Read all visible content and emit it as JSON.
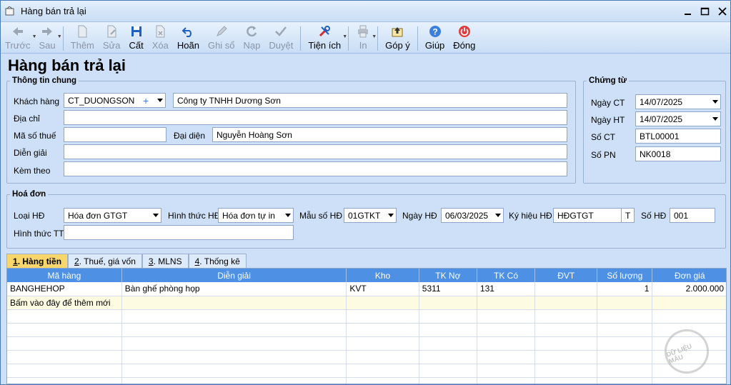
{
  "window": {
    "title": "Hàng bán trả lại"
  },
  "toolbar": {
    "items": [
      {
        "label": "Trước",
        "disabled": true
      },
      {
        "label": "Sau",
        "disabled": true
      },
      {
        "label": "Thêm",
        "disabled": true
      },
      {
        "label": "Sửa",
        "disabled": true
      },
      {
        "label": "Cất",
        "disabled": false
      },
      {
        "label": "Xóa",
        "disabled": true
      },
      {
        "label": "Hoãn",
        "disabled": false
      },
      {
        "label": "Ghi sổ",
        "disabled": true
      },
      {
        "label": "Nạp",
        "disabled": true
      },
      {
        "label": "Duyệt",
        "disabled": true
      },
      {
        "label": "Tiện ích",
        "disabled": false
      },
      {
        "label": "In",
        "disabled": true
      },
      {
        "label": "Góp ý",
        "disabled": false
      },
      {
        "label": "Giúp",
        "disabled": false
      },
      {
        "label": "Đóng",
        "disabled": false
      }
    ]
  },
  "page_title": "Hàng bán trả lại",
  "general": {
    "legend": "Thông tin chung",
    "customer_label": "Khách hàng",
    "customer_code": "CT_DUONGSON",
    "customer_name": "Công ty TNHH Dương Sơn",
    "address_label": "Địa chỉ",
    "address": "",
    "tax_label": "Mã số thuế",
    "tax": "",
    "rep_label": "Đại diện",
    "rep": "Nguyễn Hoàng Sơn",
    "desc_label": "Diễn giải",
    "desc": "",
    "attach_label": "Kèm theo",
    "attach": ""
  },
  "voucher": {
    "legend": "Chứng từ",
    "date_ct_label": "Ngày CT",
    "date_ct": "14/07/2025",
    "date_ht_label": "Ngày HT",
    "date_ht": "14/07/2025",
    "so_ct_label": "Số CT",
    "so_ct": "BTL00001",
    "so_pn_label": "Số PN",
    "so_pn": "NK0018"
  },
  "invoice": {
    "legend": "Hoá đơn",
    "type_label": "Loại HĐ",
    "type": "Hóa đơn GTGT",
    "form_label": "Hình thức HĐ",
    "form": "Hóa đơn tự in",
    "template_label": "Mẫu số HĐ",
    "template": "01GTKT",
    "date_label": "Ngày HĐ",
    "date": "06/03/2025",
    "symbol_label": "Ký hiệu HĐ",
    "symbol": "HĐGTGT",
    "symbol_btn": "T",
    "number_label": "Số HĐ",
    "number": "001",
    "pay_label": "Hình thức TT",
    "pay": ""
  },
  "tabs": [
    {
      "num": "1",
      "label": ". Hàng tiền"
    },
    {
      "num": "2",
      "label": ". Thuế, giá vốn"
    },
    {
      "num": "3",
      "label": ". MLNS"
    },
    {
      "num": "4",
      "label": ". Thống kê"
    }
  ],
  "grid": {
    "columns": [
      "Mã hàng",
      "Diễn giải",
      "Kho",
      "TK Nợ",
      "TK Có",
      "ĐVT",
      "Số lượng",
      "Đơn giá"
    ],
    "rows": [
      [
        "BANGHEHOP",
        "Bàn ghế phòng họp",
        "KVT",
        "5311",
        "131",
        "",
        "1",
        "2.000.000"
      ]
    ],
    "new_row_hint": "Bấm vào đây để thêm mới"
  },
  "watermark": "DỮ LIỆU MẪU"
}
